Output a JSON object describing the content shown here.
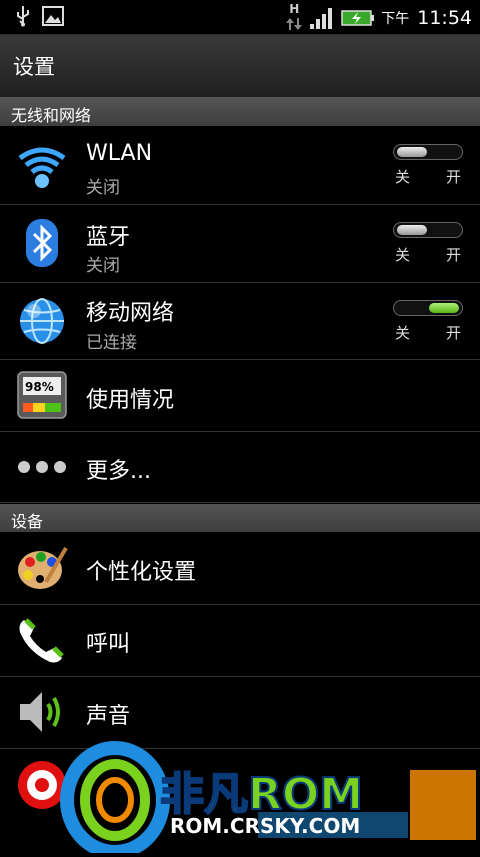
{
  "status_bar": {
    "network_type": "H",
    "ampm": "下午",
    "time": "11:54",
    "icons": [
      "usb-icon",
      "image-icon",
      "data-arrows-icon",
      "signal-icon",
      "battery-charging-icon"
    ]
  },
  "header": {
    "title": "设置"
  },
  "sections": {
    "wireless": "无线和网络",
    "device": "设备"
  },
  "toggle_labels": {
    "off": "关",
    "on": "开"
  },
  "rows": {
    "wlan": {
      "label": "WLAN",
      "sub": "关闭",
      "icon": "wifi-icon",
      "toggle": "off"
    },
    "bluetooth": {
      "label": "蓝牙",
      "sub": "关闭",
      "icon": "bluetooth-icon",
      "toggle": "off"
    },
    "mobile": {
      "label": "移动网络",
      "sub": "已连接",
      "icon": "globe-icon",
      "toggle": "on"
    },
    "usage": {
      "label": "使用情况",
      "icon": "battery-gauge-icon",
      "gauge_text": "98%"
    },
    "more": {
      "label": "更多...",
      "icon": "more-dots-icon"
    },
    "personalize": {
      "label": "个性化设置",
      "icon": "palette-icon"
    },
    "call": {
      "label": "呼叫",
      "icon": "phone-icon"
    },
    "sound": {
      "label": "声音",
      "icon": "speaker-icon"
    }
  },
  "watermark": {
    "brand": "非凡ROM",
    "url": "ROM.CRSKY.COM",
    "colors": {
      "blue": "#1e8de0",
      "green": "#7ad21e",
      "orange": "#f08a00"
    }
  }
}
